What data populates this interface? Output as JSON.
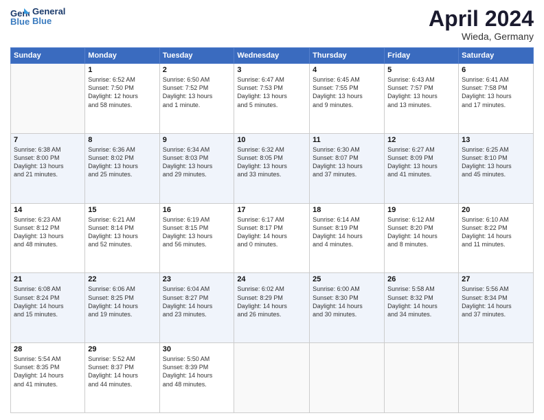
{
  "header": {
    "logo_line1": "General",
    "logo_line2": "Blue",
    "month": "April 2024",
    "location": "Wieda, Germany"
  },
  "days_of_week": [
    "Sunday",
    "Monday",
    "Tuesday",
    "Wednesday",
    "Thursday",
    "Friday",
    "Saturday"
  ],
  "weeks": [
    [
      {
        "day": "",
        "text": ""
      },
      {
        "day": "1",
        "text": "Sunrise: 6:52 AM\nSunset: 7:50 PM\nDaylight: 12 hours\nand 58 minutes."
      },
      {
        "day": "2",
        "text": "Sunrise: 6:50 AM\nSunset: 7:52 PM\nDaylight: 13 hours\nand 1 minute."
      },
      {
        "day": "3",
        "text": "Sunrise: 6:47 AM\nSunset: 7:53 PM\nDaylight: 13 hours\nand 5 minutes."
      },
      {
        "day": "4",
        "text": "Sunrise: 6:45 AM\nSunset: 7:55 PM\nDaylight: 13 hours\nand 9 minutes."
      },
      {
        "day": "5",
        "text": "Sunrise: 6:43 AM\nSunset: 7:57 PM\nDaylight: 13 hours\nand 13 minutes."
      },
      {
        "day": "6",
        "text": "Sunrise: 6:41 AM\nSunset: 7:58 PM\nDaylight: 13 hours\nand 17 minutes."
      }
    ],
    [
      {
        "day": "7",
        "text": "Sunrise: 6:38 AM\nSunset: 8:00 PM\nDaylight: 13 hours\nand 21 minutes."
      },
      {
        "day": "8",
        "text": "Sunrise: 6:36 AM\nSunset: 8:02 PM\nDaylight: 13 hours\nand 25 minutes."
      },
      {
        "day": "9",
        "text": "Sunrise: 6:34 AM\nSunset: 8:03 PM\nDaylight: 13 hours\nand 29 minutes."
      },
      {
        "day": "10",
        "text": "Sunrise: 6:32 AM\nSunset: 8:05 PM\nDaylight: 13 hours\nand 33 minutes."
      },
      {
        "day": "11",
        "text": "Sunrise: 6:30 AM\nSunset: 8:07 PM\nDaylight: 13 hours\nand 37 minutes."
      },
      {
        "day": "12",
        "text": "Sunrise: 6:27 AM\nSunset: 8:09 PM\nDaylight: 13 hours\nand 41 minutes."
      },
      {
        "day": "13",
        "text": "Sunrise: 6:25 AM\nSunset: 8:10 PM\nDaylight: 13 hours\nand 45 minutes."
      }
    ],
    [
      {
        "day": "14",
        "text": "Sunrise: 6:23 AM\nSunset: 8:12 PM\nDaylight: 13 hours\nand 48 minutes."
      },
      {
        "day": "15",
        "text": "Sunrise: 6:21 AM\nSunset: 8:14 PM\nDaylight: 13 hours\nand 52 minutes."
      },
      {
        "day": "16",
        "text": "Sunrise: 6:19 AM\nSunset: 8:15 PM\nDaylight: 13 hours\nand 56 minutes."
      },
      {
        "day": "17",
        "text": "Sunrise: 6:17 AM\nSunset: 8:17 PM\nDaylight: 14 hours\nand 0 minutes."
      },
      {
        "day": "18",
        "text": "Sunrise: 6:14 AM\nSunset: 8:19 PM\nDaylight: 14 hours\nand 4 minutes."
      },
      {
        "day": "19",
        "text": "Sunrise: 6:12 AM\nSunset: 8:20 PM\nDaylight: 14 hours\nand 8 minutes."
      },
      {
        "day": "20",
        "text": "Sunrise: 6:10 AM\nSunset: 8:22 PM\nDaylight: 14 hours\nand 11 minutes."
      }
    ],
    [
      {
        "day": "21",
        "text": "Sunrise: 6:08 AM\nSunset: 8:24 PM\nDaylight: 14 hours\nand 15 minutes."
      },
      {
        "day": "22",
        "text": "Sunrise: 6:06 AM\nSunset: 8:25 PM\nDaylight: 14 hours\nand 19 minutes."
      },
      {
        "day": "23",
        "text": "Sunrise: 6:04 AM\nSunset: 8:27 PM\nDaylight: 14 hours\nand 23 minutes."
      },
      {
        "day": "24",
        "text": "Sunrise: 6:02 AM\nSunset: 8:29 PM\nDaylight: 14 hours\nand 26 minutes."
      },
      {
        "day": "25",
        "text": "Sunrise: 6:00 AM\nSunset: 8:30 PM\nDaylight: 14 hours\nand 30 minutes."
      },
      {
        "day": "26",
        "text": "Sunrise: 5:58 AM\nSunset: 8:32 PM\nDaylight: 14 hours\nand 34 minutes."
      },
      {
        "day": "27",
        "text": "Sunrise: 5:56 AM\nSunset: 8:34 PM\nDaylight: 14 hours\nand 37 minutes."
      }
    ],
    [
      {
        "day": "28",
        "text": "Sunrise: 5:54 AM\nSunset: 8:35 PM\nDaylight: 14 hours\nand 41 minutes."
      },
      {
        "day": "29",
        "text": "Sunrise: 5:52 AM\nSunset: 8:37 PM\nDaylight: 14 hours\nand 44 minutes."
      },
      {
        "day": "30",
        "text": "Sunrise: 5:50 AM\nSunset: 8:39 PM\nDaylight: 14 hours\nand 48 minutes."
      },
      {
        "day": "",
        "text": ""
      },
      {
        "day": "",
        "text": ""
      },
      {
        "day": "",
        "text": ""
      },
      {
        "day": "",
        "text": ""
      }
    ]
  ]
}
